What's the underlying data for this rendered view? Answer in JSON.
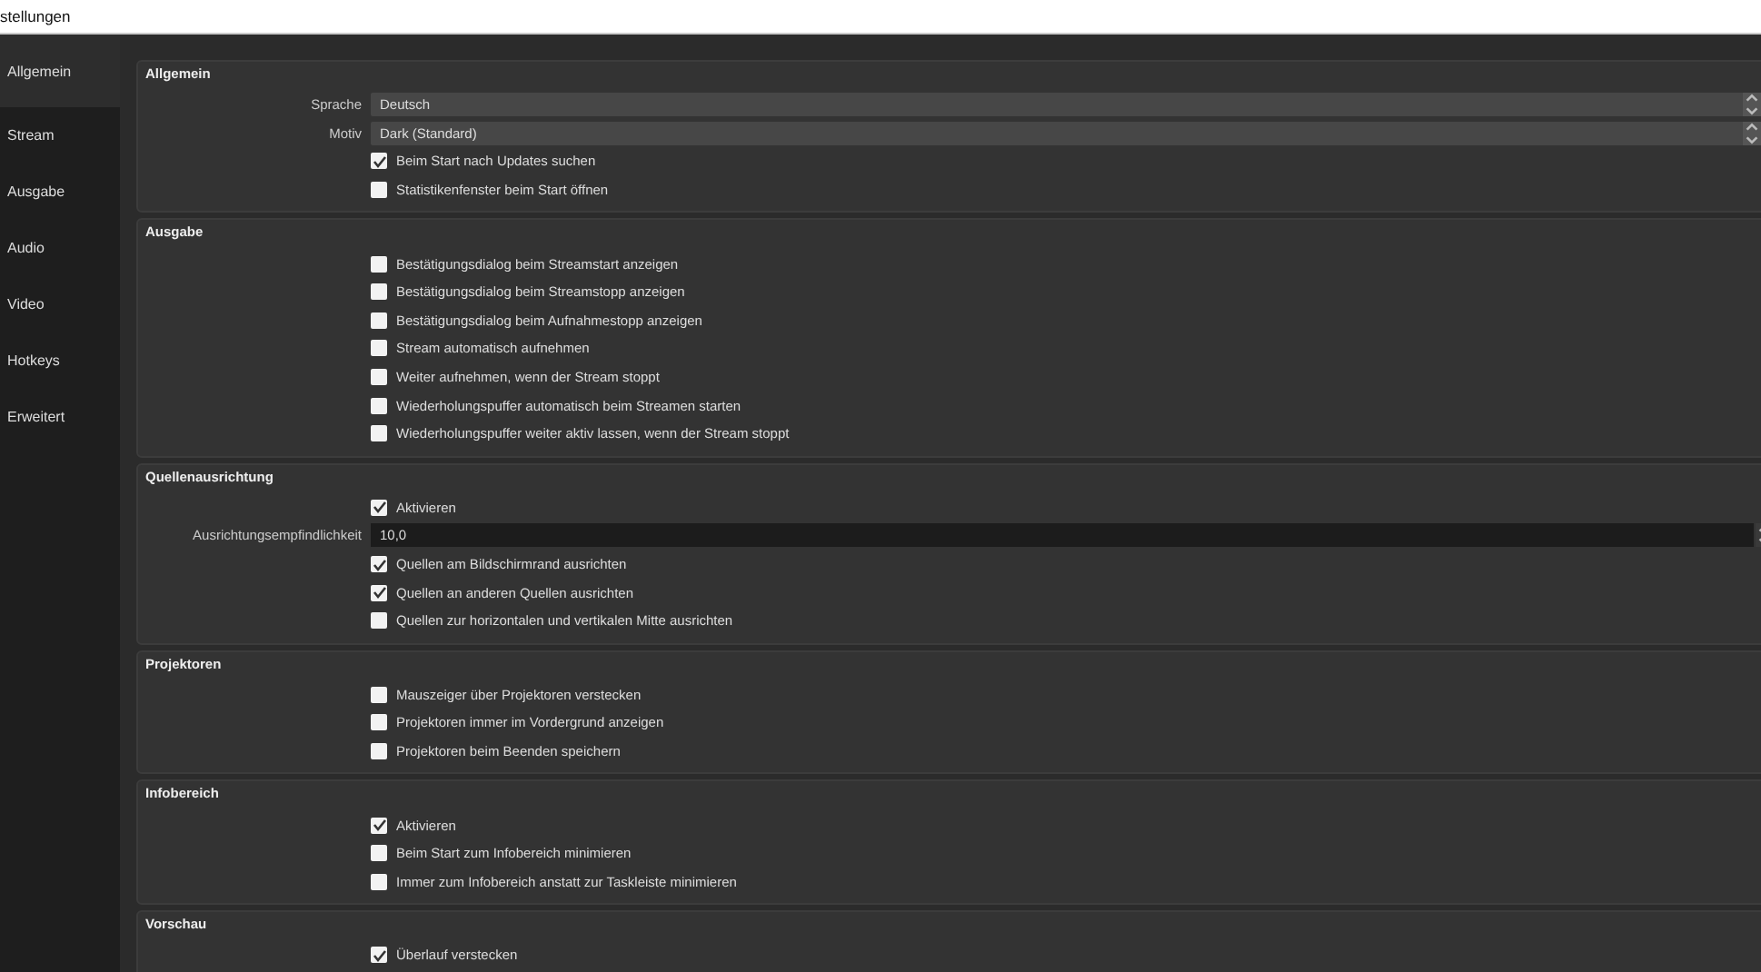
{
  "window": {
    "title": "stellungen"
  },
  "sidebar": {
    "items": [
      {
        "label": "Allgemein",
        "selected": true
      },
      {
        "label": "Stream",
        "selected": false
      },
      {
        "label": "Ausgabe",
        "selected": false
      },
      {
        "label": "Audio",
        "selected": false
      },
      {
        "label": "Video",
        "selected": false
      },
      {
        "label": "Hotkeys",
        "selected": false
      },
      {
        "label": "Erweitert",
        "selected": false
      }
    ]
  },
  "groups": [
    {
      "title": "Allgemein",
      "rows": [
        {
          "kind": "select",
          "label": "Sprache",
          "value": "Deutsch"
        },
        {
          "kind": "select",
          "label": "Motiv",
          "value": "Dark (Standard)"
        },
        {
          "kind": "checkbox",
          "label": "Beim Start nach Updates suchen",
          "checked": true
        },
        {
          "kind": "checkbox",
          "label": "Statistikenfenster beim Start öffnen",
          "checked": false
        }
      ]
    },
    {
      "title": "Ausgabe",
      "rows": [
        {
          "kind": "checkbox",
          "label": "Bestätigungsdialog beim Streamstart anzeigen",
          "checked": false
        },
        {
          "kind": "checkbox",
          "label": "Bestätigungsdialog beim Streamstopp anzeigen",
          "checked": false
        },
        {
          "kind": "checkbox",
          "label": "Bestätigungsdialog beim Aufnahmestopp anzeigen",
          "checked": false
        },
        {
          "kind": "checkbox",
          "label": "Stream automatisch aufnehmen",
          "checked": false
        },
        {
          "kind": "checkbox",
          "label": "Weiter aufnehmen, wenn der Stream stoppt",
          "checked": false
        },
        {
          "kind": "checkbox",
          "label": "Wiederholungspuffer automatisch beim Streamen starten",
          "checked": false
        },
        {
          "kind": "checkbox",
          "label": "Wiederholungspuffer weiter aktiv lassen, wenn der Stream stoppt",
          "checked": false
        }
      ]
    },
    {
      "title": "Quellenausrichtung",
      "rows": [
        {
          "kind": "checkbox",
          "label": "Aktivieren",
          "checked": true
        },
        {
          "kind": "spin",
          "label": "Ausrichtungsempfindlichkeit",
          "value": "10,0"
        },
        {
          "kind": "checkbox",
          "label": "Quellen am Bildschirmrand ausrichten",
          "checked": true
        },
        {
          "kind": "checkbox",
          "label": "Quellen an anderen Quellen ausrichten",
          "checked": true
        },
        {
          "kind": "checkbox",
          "label": "Quellen zur horizontalen und vertikalen Mitte ausrichten",
          "checked": false
        }
      ]
    },
    {
      "title": "Projektoren",
      "rows": [
        {
          "kind": "checkbox",
          "label": "Mauszeiger über Projektoren verstecken",
          "checked": false
        },
        {
          "kind": "checkbox",
          "label": "Projektoren immer im Vordergrund anzeigen",
          "checked": false
        },
        {
          "kind": "checkbox",
          "label": "Projektoren beim Beenden speichern",
          "checked": false
        }
      ]
    },
    {
      "title": "Infobereich",
      "rows": [
        {
          "kind": "checkbox",
          "label": "Aktivieren",
          "checked": true
        },
        {
          "kind": "checkbox",
          "label": "Beim Start zum Infobereich minimieren",
          "checked": false
        },
        {
          "kind": "checkbox",
          "label": "Immer zum Infobereich anstatt zur Taskleiste minimieren",
          "checked": false
        }
      ]
    },
    {
      "title": "Vorschau",
      "rows": [
        {
          "kind": "checkbox",
          "label": "Überlauf verstecken",
          "checked": true
        }
      ]
    }
  ]
}
